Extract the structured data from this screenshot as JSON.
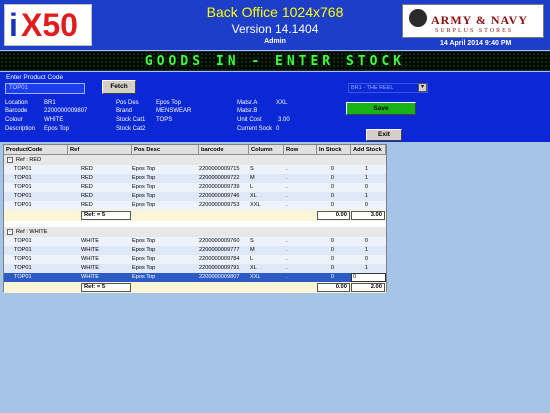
{
  "header": {
    "logo": "iX50",
    "title": "Back Office 1024x768",
    "version": "Version 14.1404",
    "user": "Admin",
    "brand_line1": "ARMY & NAVY",
    "brand_line2": "SURPLUS STORES",
    "datetime": "14 April 2014 9:40 PM"
  },
  "banner": {
    "text": "GOODS IN - ENTER STOCK"
  },
  "product": {
    "label": "Enter Product Code",
    "value": "TOP01",
    "fetch_label": "Fetch",
    "store_value": "BR1 - THE REEL"
  },
  "info": {
    "location_label": "Location",
    "location_value": "BR1",
    "barcode_label": "Barcode",
    "barcode_value": "2200000009807",
    "colour_label": "Colour",
    "colour_value": "WHITE",
    "description_label": "Description",
    "description_value": "Epos Top",
    "posdes_label": "Pos Des",
    "posdes_value": "Epos Top",
    "brand_label": "Brand",
    "brand_value": "MENSWEAR",
    "cat1_label": "Stock Cat1",
    "cat1_value": "TOPS",
    "cat2_label": "Stock Cat2",
    "cat2_value": "",
    "matsa_label": "Matsr.A",
    "matsa_value": "XXL",
    "matsb_label": "Matsr.B",
    "matsb_value": "",
    "unitcost_label": "Unit Cost",
    "unitcost_value": "3.00",
    "currentstock_label": "Current Sock",
    "currentstock_value": "0",
    "save_label": "Save",
    "exit_label": "Exit"
  },
  "grid": {
    "columns": [
      "ProductCode",
      "Ref",
      "Pos Desc",
      "barcode",
      "Column",
      "Row",
      "In Stock",
      "Add Stock"
    ],
    "groups": [
      {
        "title": "Ref : RED",
        "toggle": "-",
        "rows": [
          [
            "TOP01",
            "RED",
            "Epos Top",
            "2200000009715",
            "S",
            ".",
            "0",
            "1"
          ],
          [
            "TOP01",
            "RED",
            "Epos Top",
            "2200000009722",
            "M",
            ".",
            "0",
            "1"
          ],
          [
            "TOP01",
            "RED",
            "Epos Top",
            "2200000009739",
            "L",
            ".",
            "0",
            "0"
          ],
          [
            "TOP01",
            "RED",
            "Epos Top",
            "2200000009746",
            "XL",
            ".",
            "0",
            "1"
          ],
          [
            "TOP01",
            "RED",
            "Epos Top",
            "2200000009753",
            "XXL",
            ".",
            "0",
            "0"
          ]
        ],
        "summary": {
          "ref": "Ref: = 5",
          "instock": "0.00",
          "addstock": "3.00"
        }
      },
      {
        "title": "Ref : WHITE",
        "toggle": "-",
        "rows": [
          [
            "TOP01",
            "WHITE",
            "Epos Top",
            "2200000009760",
            "S",
            ".",
            "0",
            "0"
          ],
          [
            "TOP01",
            "WHITE",
            "Epos Top",
            "2200000009777",
            "M",
            ".",
            "0",
            "1"
          ],
          [
            "TOP01",
            "WHITE",
            "Epos Top",
            "2200000009784",
            "L",
            ".",
            "0",
            "0"
          ],
          [
            "TOP01",
            "WHITE",
            "Epos Top",
            "2200000009791",
            "XL",
            ".",
            "0",
            "1"
          ],
          [
            "TOP01",
            "WHITE",
            "Epos Top",
            "2200000009807",
            "XXL",
            ".",
            "0",
            "0"
          ]
        ],
        "summary": {
          "ref": "Ref: = 5",
          "instock": "0.00",
          "addstock": "2.00"
        }
      }
    ],
    "selected": {
      "group": 1,
      "row": 4
    }
  },
  "colors": {
    "header_bg": "#1c3ec8",
    "panel_bg": "#0a28d6",
    "banner_text": "#3cff3c",
    "title_text": "#ffff00",
    "save_button": "#17b317",
    "selected_row": "#2c5cc3",
    "desktop_bg": "#a6c4e8"
  }
}
